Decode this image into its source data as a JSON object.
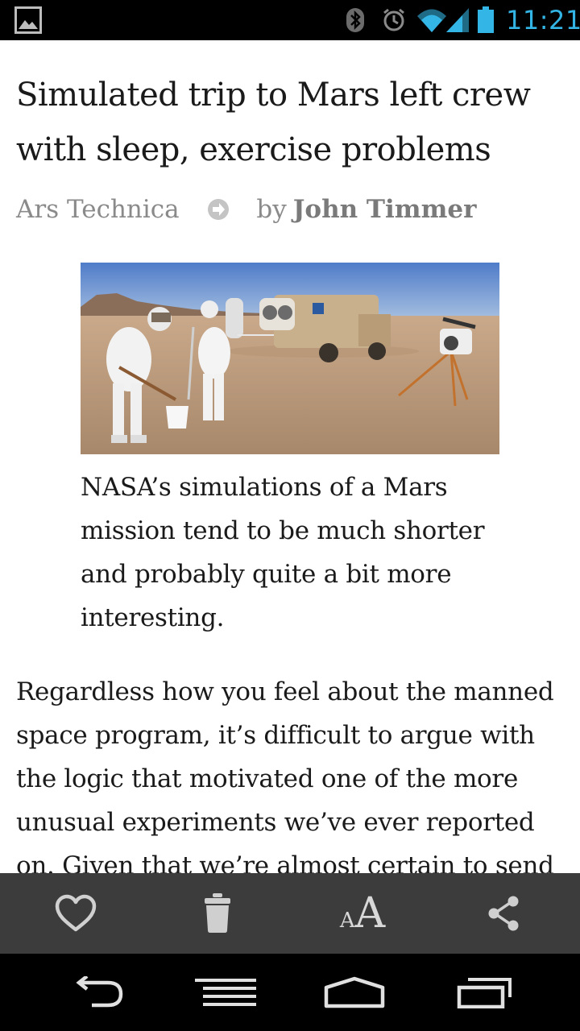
{
  "status_bar": {
    "time": "11:21",
    "icons": [
      "image-notification-icon",
      "bluetooth-icon",
      "alarm-icon",
      "wifi-icon",
      "signal-icon",
      "battery-icon"
    ],
    "accent_color": "#33b5e5"
  },
  "article": {
    "title": "Simulated trip to Mars left crew with sleep, exercise problems",
    "source": "Ars Technica",
    "author_prefix": "by",
    "author": "John Timmer",
    "image_caption": "NASA’s simulations of a Mars mission tend to be much shorter and probably quite a bit more interesting.",
    "body": "Regardless how you feel about the manned space program, it’s difficult to argue with the logic that motivated one of the more unusual experiments we’ve ever reported on. Given that we’re almost certain to send"
  },
  "action_bar": {
    "background": "#3c3c3c",
    "actions": [
      {
        "icon": "heart-icon"
      },
      {
        "icon": "trash-icon"
      },
      {
        "icon": "font-size-icon",
        "glyph_small": "A",
        "glyph_large": "A"
      },
      {
        "icon": "share-icon"
      }
    ]
  },
  "nav_bar": {
    "buttons": [
      "back-icon",
      "menu-icon",
      "home-icon",
      "recent-apps-icon"
    ]
  }
}
